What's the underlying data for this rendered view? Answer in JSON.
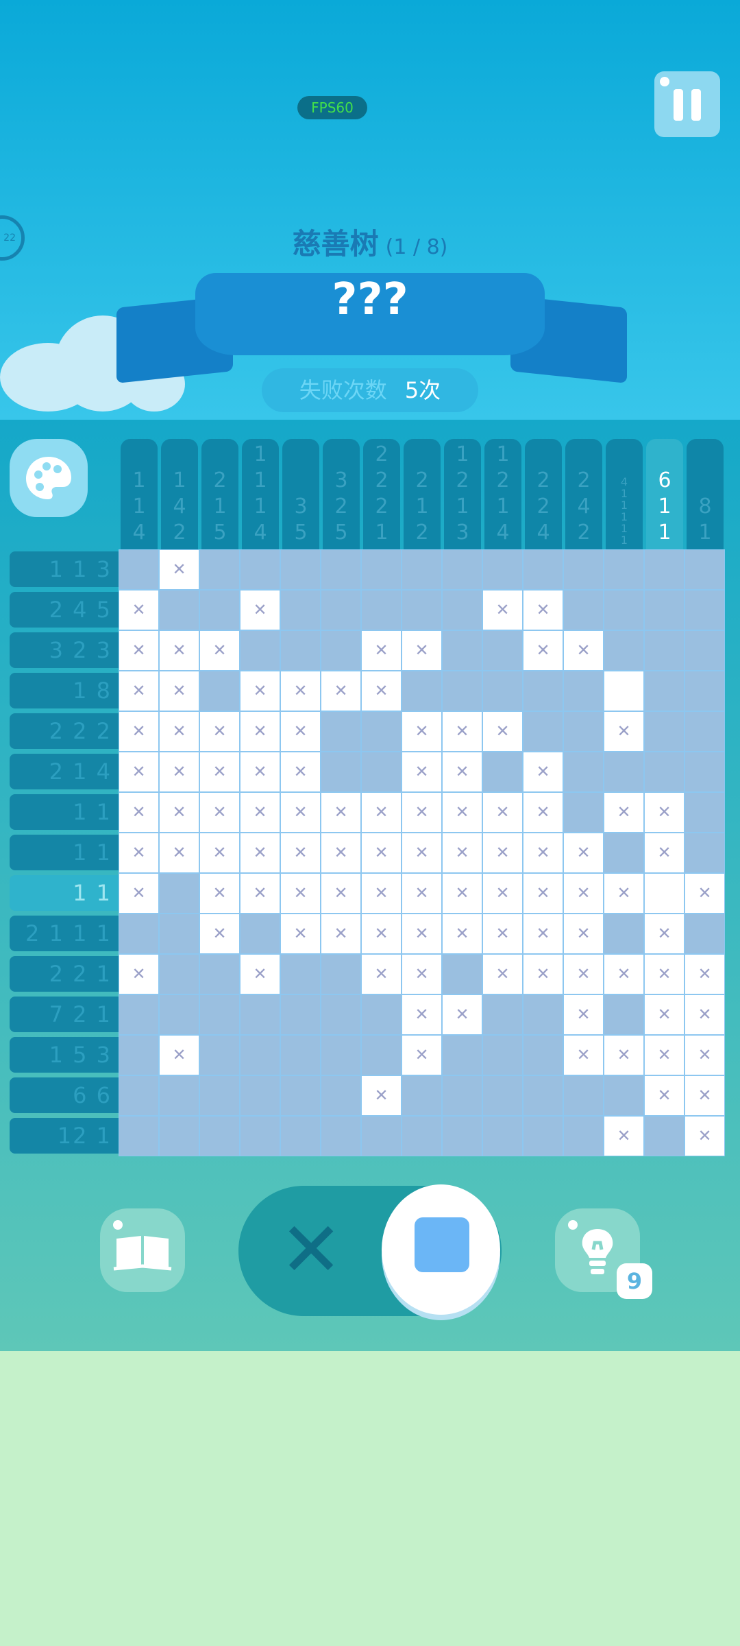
{
  "status": {
    "fps_label": "FPS60"
  },
  "level": {
    "title": "慈善树",
    "progress": "(1 / 8)",
    "puzzle_name": "???"
  },
  "fails": {
    "label": "失败次数",
    "value": "5次"
  },
  "side_badge": "22",
  "column_clues": [
    [
      "1",
      "1",
      "4"
    ],
    [
      "1",
      "4",
      "2"
    ],
    [
      "2",
      "1",
      "5"
    ],
    [
      "1",
      "1",
      "1",
      "4"
    ],
    [
      "3",
      "5"
    ],
    [
      "3",
      "2",
      "5"
    ],
    [
      "2",
      "2",
      "2",
      "1"
    ],
    [
      "2",
      "1",
      "2"
    ],
    [
      "1",
      "2",
      "1",
      "3"
    ],
    [
      "1",
      "2",
      "1",
      "4"
    ],
    [
      "2",
      "2",
      "4"
    ],
    [
      "2",
      "4",
      "2"
    ],
    [
      "4",
      "1",
      "1",
      "1",
      "1",
      "1"
    ],
    [
      "6",
      "1",
      "1"
    ],
    [
      "8",
      "1"
    ]
  ],
  "active_column": 13,
  "row_clues": [
    "1 1 3",
    "2 4 5",
    "3 2 3",
    "1 8",
    "2 2 2",
    "2 1 4",
    "1 1",
    "1 1",
    "1 1",
    "2 1 1 1",
    "2 2 1",
    "7 2 1",
    "1 5 3",
    "6 6",
    "12 1"
  ],
  "active_row": 8,
  "grid": [
    "fxfffffffffffff",
    "xffxfffffxxffff",
    "xxxfffxxffxxfff",
    "xxfxxxxfffffeff",
    "xxxxxffxxxffxff",
    "xxxxxffxxfxffff",
    "xxxxxxxxxxxfxxf",
    "xxxxxxxxxxxxfxf",
    "xfxxxxxxxxxxxex",
    "ffxfxxxxxxxxfxf",
    "xffxffxxfxxxxxx",
    "fffffffxxffxfxx",
    "fxfffffxfffxxxx",
    "ffffffxffffffxx",
    "ffffffffffffxfx"
  ],
  "toolbar": {
    "hint_count": "9",
    "mode": "fill"
  },
  "colors": {
    "filled": "#9abfe0",
    "crossed": "#ffffff",
    "accent": "#1a8fd4"
  }
}
